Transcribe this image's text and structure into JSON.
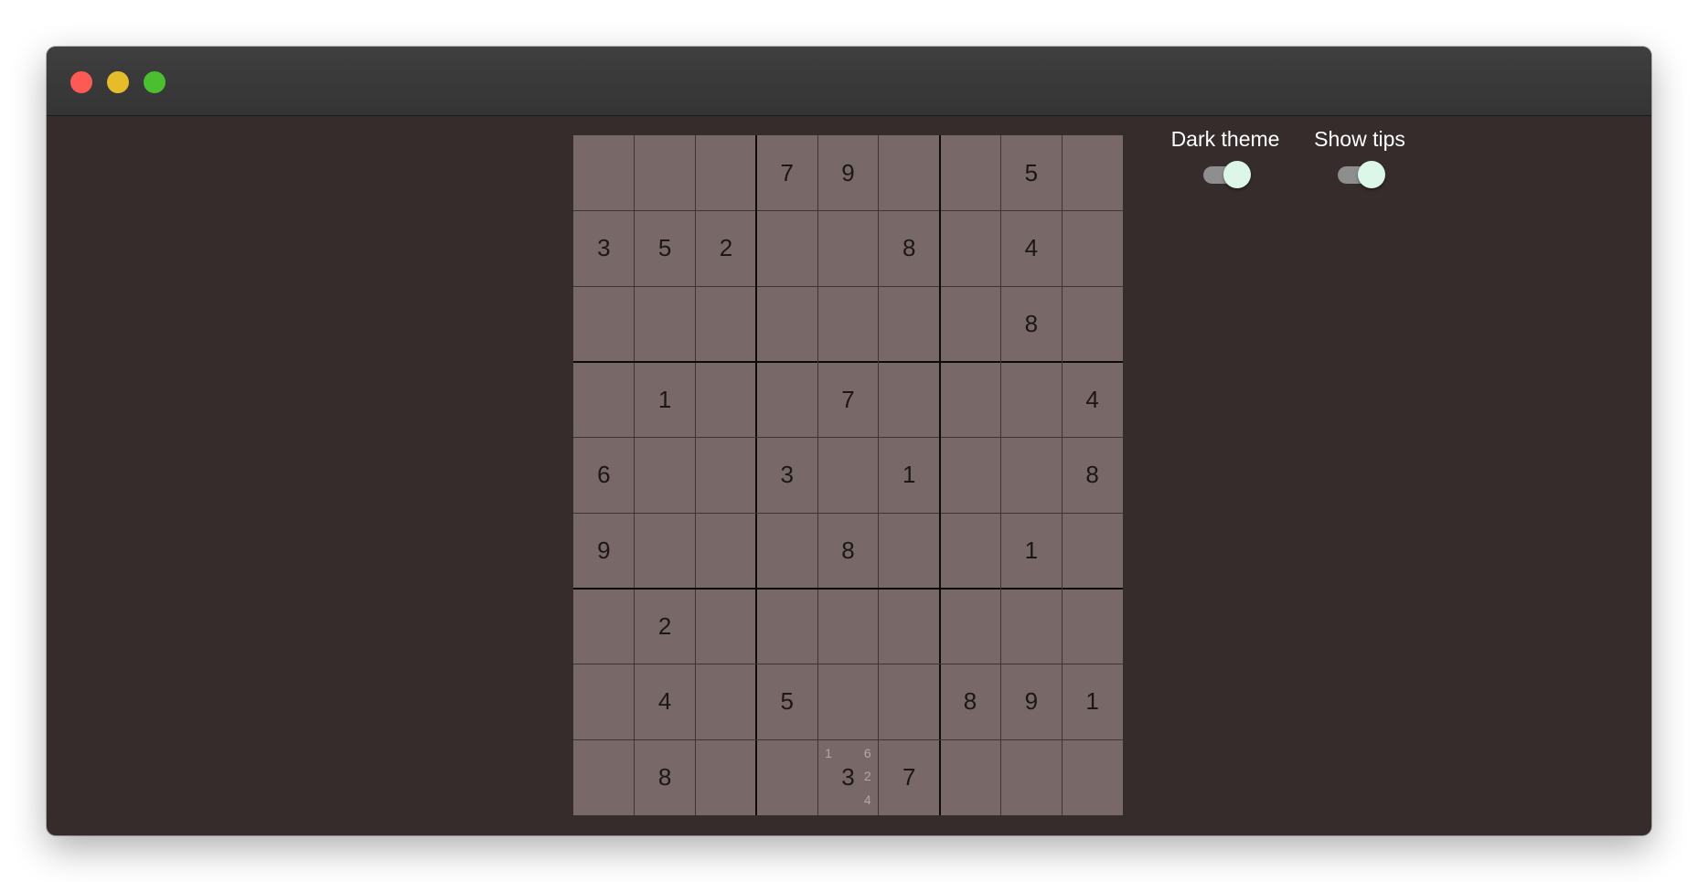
{
  "window": {
    "controls": [
      "close",
      "minimize",
      "maximize"
    ]
  },
  "settings": [
    {
      "label": "Dark theme",
      "on": true
    },
    {
      "label": "Show tips",
      "on": true
    }
  ],
  "board": {
    "rows": [
      [
        "",
        "",
        "",
        "7",
        "9",
        "",
        "",
        "5",
        ""
      ],
      [
        "3",
        "5",
        "2",
        "",
        "",
        "8",
        "",
        "4",
        ""
      ],
      [
        "",
        "",
        "",
        "",
        "",
        "",
        "",
        "8",
        ""
      ],
      [
        "",
        "1",
        "",
        "",
        "7",
        "",
        "",
        "",
        "4"
      ],
      [
        "6",
        "",
        "",
        "3",
        "",
        "1",
        "",
        "",
        "8"
      ],
      [
        "9",
        "",
        "",
        "",
        "8",
        "",
        "",
        "1",
        ""
      ],
      [
        "",
        "2",
        "",
        "",
        "",
        "",
        "",
        "",
        ""
      ],
      [
        "",
        "4",
        "",
        "5",
        "",
        "",
        "8",
        "9",
        "1"
      ],
      [
        "",
        "8",
        "",
        "",
        "3",
        "7",
        "",
        "",
        ""
      ]
    ],
    "tips": [
      {
        "row": 8,
        "col": 4,
        "candidates": [
          "1",
          "6",
          "2",
          "4"
        ]
      }
    ]
  },
  "colors": {
    "window_bg": "#352c2b",
    "cell_bg": "#796868",
    "digit": "#1c1616",
    "tip_digit": "#b3a7a7",
    "toggle_thumb": "#dcf6e8",
    "toggle_track": "#8e8e8e"
  }
}
